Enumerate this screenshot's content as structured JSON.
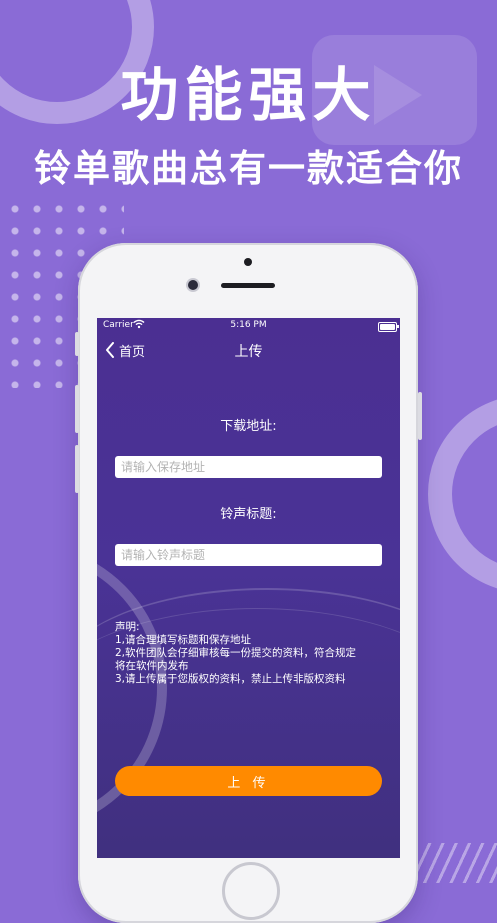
{
  "promo": {
    "headline": "功能强大",
    "subline": "铃单歌曲总有一款适合你"
  },
  "status_bar": {
    "carrier": "Carrier",
    "time": "5:16 PM"
  },
  "nav": {
    "back_label": "首页",
    "title": "上传"
  },
  "form": {
    "download_label": "下载地址:",
    "download_placeholder": "请输入保存地址",
    "ringtone_label": "铃声标题:",
    "ringtone_placeholder": "请输入铃声标题"
  },
  "notes": {
    "heading": "声明:",
    "lines": [
      "1,请合理填写标题和保存地址",
      "2,软件团队会仔细审核每一份提交的资料，符合规定",
      "将在软件内发布",
      "3,请上传属于您版权的资料，禁止上传非版权资料"
    ]
  },
  "upload_button": {
    "label": "上 传"
  },
  "colors": {
    "background": "#8a6bd6",
    "screen_gradient_top": "#4b2f92",
    "screen_gradient_bottom": "#40307f",
    "accent_button": "#ff8a00"
  },
  "icons": [
    "wifi-icon",
    "battery-icon",
    "chevron-left-icon"
  ]
}
